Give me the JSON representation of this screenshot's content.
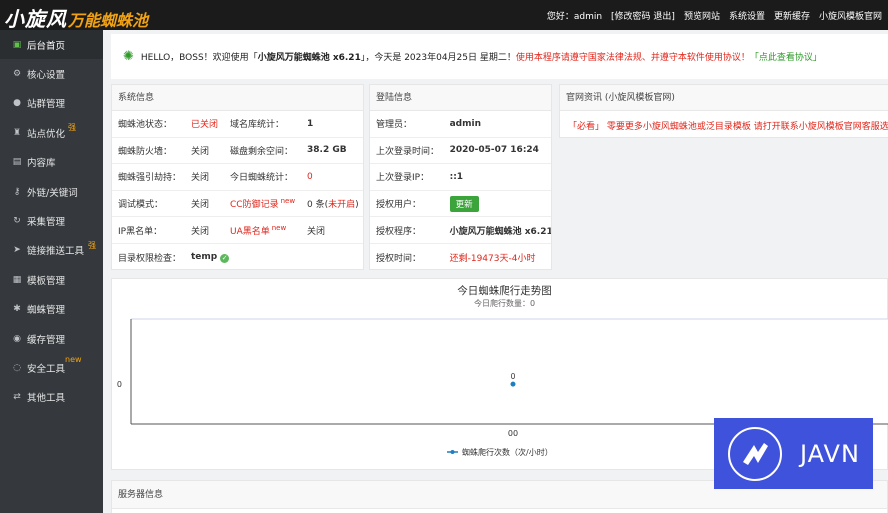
{
  "header": {
    "logo_main": "小旋风",
    "logo_sub": "万能蜘蛛池",
    "greeting": "您好：admin",
    "links": [
      "[修改密码 退出]",
      "预览网站",
      "系统设置",
      "更新缓存",
      "小旋风模板官网"
    ]
  },
  "sidebar": {
    "items": [
      {
        "label": "后台首页",
        "icon": "home-icon",
        "badge": ""
      },
      {
        "label": "核心设置",
        "icon": "gear-icon",
        "badge": ""
      },
      {
        "label": "站群管理",
        "icon": "user-icon",
        "badge": ""
      },
      {
        "label": "站点优化",
        "icon": "trophy-icon",
        "badge": "强"
      },
      {
        "label": "内容库",
        "icon": "document-icon",
        "badge": ""
      },
      {
        "label": "外链/关键词",
        "icon": "key-icon",
        "badge": ""
      },
      {
        "label": "采集管理",
        "icon": "sync-icon",
        "badge": ""
      },
      {
        "label": "链接推送工具",
        "icon": "send-icon",
        "badge": "强"
      },
      {
        "label": "模板管理",
        "icon": "grid-icon",
        "badge": ""
      },
      {
        "label": "蜘蛛管理",
        "icon": "bug-icon",
        "badge": ""
      },
      {
        "label": "缓存管理",
        "icon": "cache-icon",
        "badge": ""
      },
      {
        "label": "安全工具",
        "icon": "bulb-icon",
        "badge": "new"
      },
      {
        "label": "其他工具",
        "icon": "shuffle-icon",
        "badge": ""
      }
    ]
  },
  "notice": {
    "icon": "sun-icon",
    "hello": "HELLO，BOSS！欢迎使用「",
    "product": "小旋风万能蜘蛛池 x6.21",
    "date_text": "」，今天是 2023年04月25日 星期二！",
    "warning": "使用本程序请遵守国家法律法规、并遵守本软件使用协议！",
    "agreement": "「点此查看协议」"
  },
  "system_info": {
    "title": "系统信息",
    "rows": [
      [
        "蜘蛛池状态：",
        "已关闭",
        "域名库统计：",
        "1"
      ],
      [
        "蜘蛛防火墙：",
        "关闭",
        "磁盘剩余空间：",
        "38.2 GB"
      ],
      [
        "蜘蛛强引劫持：",
        "关闭",
        "今日蜘蛛统计：",
        "0"
      ],
      [
        "调试模式：",
        "关闭",
        "CC防御记录",
        "0 条(",
        "未开启",
        ")"
      ],
      [
        "IP黑名单：",
        "关闭",
        "UA黑名单",
        "关闭"
      ],
      [
        "目录权限检查：",
        "temp"
      ]
    ],
    "new_tag": "new"
  },
  "login_info": {
    "title": "登陆信息",
    "rows": [
      [
        "管理员：",
        "admin"
      ],
      [
        "上次登录时间：",
        "2020-05-07 16:24"
      ],
      [
        "上次登录IP：",
        "::1"
      ],
      [
        "授权用户：",
        "更新"
      ],
      [
        "授权程序：",
        "小旋风万能蜘蛛池 x6.21"
      ],
      [
        "授权时间：",
        "还剩-19473天-4小时"
      ]
    ]
  },
  "official": {
    "title": "官网资讯 (小旋风模板官网)",
    "text": "「必看」 零要更多小旋风蜘蛛池或泛目录模板 请打开联系小旋风模板官网客服选购（官"
  },
  "chart_data": {
    "type": "line",
    "title": "今日蜘蛛爬行走势图",
    "subtitle": "今日爬行数量：0",
    "categories": [
      "00"
    ],
    "series": [
      {
        "name": "蜘蛛爬行次数（次/小时）",
        "values": [
          0
        ]
      }
    ],
    "ylabel": "",
    "y_tick_labels": [
      "0"
    ],
    "data_labels": [
      "0"
    ],
    "color": "#1f7ec1"
  },
  "server_info": {
    "title": "服务器信息"
  },
  "watermark": {
    "text": "JAVN"
  }
}
